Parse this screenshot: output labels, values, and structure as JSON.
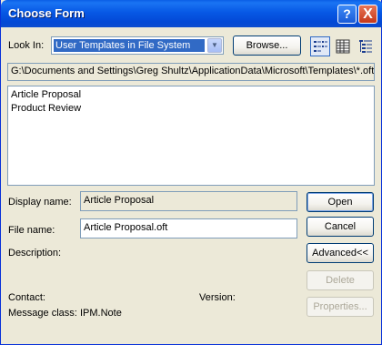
{
  "window": {
    "title": "Choose Form"
  },
  "icons": {
    "help": "help-icon",
    "close": "close-icon",
    "dropdown": "chevron-down-icon",
    "view_list": "list-view-icon",
    "view_details": "details-view-icon",
    "view_tree": "tree-view-icon"
  },
  "title_buttons": {
    "help": "?",
    "close": "X"
  },
  "look_in": {
    "label": "Look In:",
    "value": "User Templates in File System"
  },
  "browse_label": "Browse...",
  "path": "G:\\Documents and Settings\\Greg Shultz\\ApplicationData\\Microsoft\\Templates\\*.oft",
  "forms": [
    {
      "name": "Article Proposal",
      "selected": true
    },
    {
      "name": "Product Review",
      "selected": false
    }
  ],
  "display_name": {
    "label": "Display name:",
    "value": "Article Proposal"
  },
  "file_name": {
    "label": "File name:",
    "value": "Article Proposal.oft"
  },
  "description_label": "Description:",
  "contact_label": "Contact:",
  "version_label": "Version:",
  "message_class": {
    "label": "Message class:",
    "value": "IPM.Note"
  },
  "buttons": {
    "open": "Open",
    "cancel": "Cancel",
    "advanced": "Advanced<<",
    "delete": "Delete",
    "properties": "Properties..."
  },
  "colors": {
    "title_bar": "#0758e5",
    "selection": "#316ac5",
    "dialog_bg": "#ece9d8"
  }
}
